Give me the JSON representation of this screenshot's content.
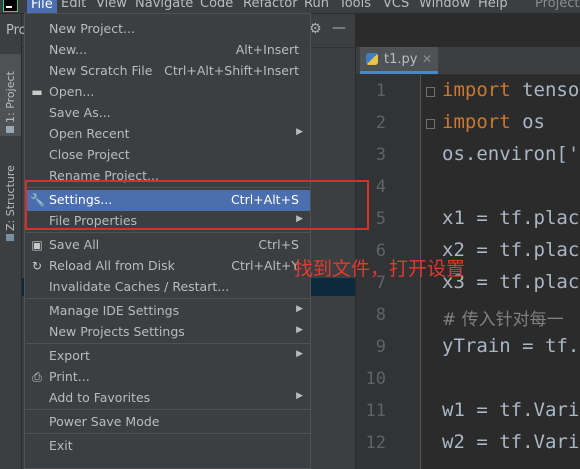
{
  "menubar": {
    "items": [
      "File",
      "Edit",
      "View",
      "Navigate",
      "Code",
      "Refactor",
      "Run",
      "Tools",
      "VCS",
      "Window",
      "Help"
    ],
    "project_right": "Project"
  },
  "left_strip": {
    "project_tab": "1: Project",
    "structure_tab": "Z: Structure"
  },
  "project_panel": {
    "title": "Proj"
  },
  "editor": {
    "tab": {
      "label": "t1.py"
    },
    "line_numbers": [
      "1",
      "2",
      "3",
      "4",
      "5",
      "6",
      "7",
      "8",
      "9",
      "10",
      "11",
      "12"
    ],
    "lines": [
      {
        "kw": "import",
        "rest": " tenso"
      },
      {
        "kw": "import",
        "rest": " os"
      },
      {
        "kw": "",
        "rest": "os.environ['"
      },
      {
        "kw": "",
        "rest": ""
      },
      {
        "kw": "",
        "rest": "x1 = tf.plac"
      },
      {
        "kw": "",
        "rest": "x2 = tf.plac"
      },
      {
        "kw": "",
        "rest": "x3 = tf.plac"
      },
      {
        "comment": "# 传入针对每一"
      },
      {
        "kw": "",
        "rest": "yTrain = tf."
      },
      {
        "kw": "",
        "rest": ""
      },
      {
        "kw": "",
        "rest": "w1 = tf.Vari"
      },
      {
        "kw": "",
        "rest": "w2 = tf.Vari"
      }
    ]
  },
  "file_menu": {
    "items": [
      {
        "label": "New Project...",
        "shortcut": "",
        "submenu": false,
        "icon": ""
      },
      {
        "label": "New...",
        "shortcut": "Alt+Insert",
        "submenu": false,
        "icon": ""
      },
      {
        "label": "New Scratch File",
        "shortcut": "Ctrl+Alt+Shift+Insert",
        "submenu": false,
        "icon": ""
      },
      {
        "label": "Open...",
        "shortcut": "",
        "submenu": false,
        "icon": "folder-icon"
      },
      {
        "label": "Save As...",
        "shortcut": "",
        "submenu": false,
        "icon": ""
      },
      {
        "label": "Open Recent",
        "shortcut": "",
        "submenu": true,
        "icon": ""
      },
      {
        "label": "Close Project",
        "shortcut": "",
        "submenu": false,
        "icon": ""
      },
      {
        "label": "Rename Project...",
        "shortcut": "",
        "submenu": false,
        "icon": ""
      },
      {
        "label": "Settings...",
        "shortcut": "Ctrl+Alt+S",
        "submenu": false,
        "icon": "wrench-icon",
        "highlighted": true
      },
      {
        "label": "File Properties",
        "shortcut": "",
        "submenu": true,
        "icon": ""
      },
      {
        "label": "Save All",
        "shortcut": "Ctrl+S",
        "submenu": false,
        "icon": "save-icon"
      },
      {
        "label": "Reload All from Disk",
        "shortcut": "Ctrl+Alt+Y",
        "submenu": false,
        "icon": "reload-icon"
      },
      {
        "label": "Invalidate Caches / Restart...",
        "shortcut": "",
        "submenu": false,
        "icon": ""
      },
      {
        "label": "Manage IDE Settings",
        "shortcut": "",
        "submenu": true,
        "icon": ""
      },
      {
        "label": "New Projects Settings",
        "shortcut": "",
        "submenu": true,
        "icon": ""
      },
      {
        "label": "Export",
        "shortcut": "",
        "submenu": true,
        "icon": ""
      },
      {
        "label": "Print...",
        "shortcut": "",
        "submenu": false,
        "icon": "print-icon"
      },
      {
        "label": "Add to Favorites",
        "shortcut": "",
        "submenu": true,
        "icon": ""
      },
      {
        "label": "Power Save Mode",
        "shortcut": "",
        "submenu": false,
        "icon": ""
      },
      {
        "label": "Exit",
        "shortcut": "",
        "submenu": false,
        "icon": ""
      }
    ]
  },
  "annotation": {
    "text": "找到文件，打开设置"
  },
  "colors": {
    "highlight": "#4b6eaf",
    "annotation_red": "#d6302c",
    "keyword": "#cc7832",
    "code_text": "#a9b7c6"
  }
}
